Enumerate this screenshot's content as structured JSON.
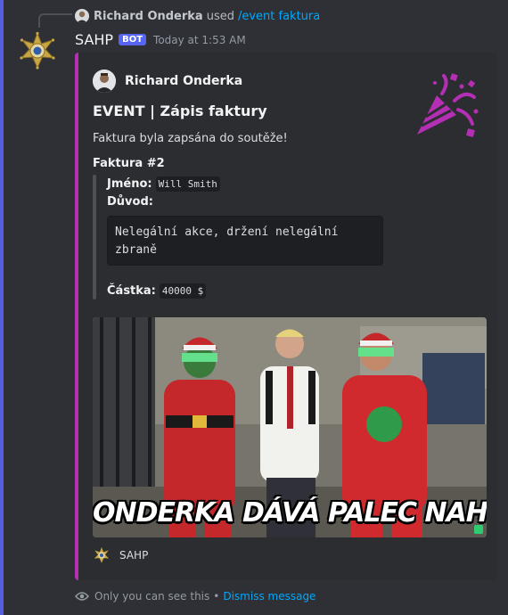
{
  "reply": {
    "user": "Richard Onderka",
    "used": "used",
    "command": "/event faktura"
  },
  "message": {
    "bot_name": "SAHP",
    "bot_badge": "BOT",
    "timestamp": "Today at 1:53 AM"
  },
  "embed": {
    "accent_color": "#b52fb4",
    "author": "Richard Onderka",
    "title": "EVENT | Zápis faktury",
    "description": "Faktura byla zapsána do soutěže!",
    "field_title": "Faktura #2",
    "name_label": "Jméno:",
    "name_value": "Will Smith",
    "reason_label": "Důvod:",
    "reason_line1": "Nelegální akce, držení nelegální",
    "reason_line2": "zbraně",
    "amount_label": "Částka:",
    "amount_value": "40000 $",
    "image_caption": "ONDERKA DÁVÁ PALEC NAHORU",
    "footer": "SAHP",
    "thumbnail_icon": "party-popper-icon"
  },
  "ephemeral": {
    "text": "Only you can see this",
    "separator": "•",
    "dismiss": "Dismiss message"
  }
}
